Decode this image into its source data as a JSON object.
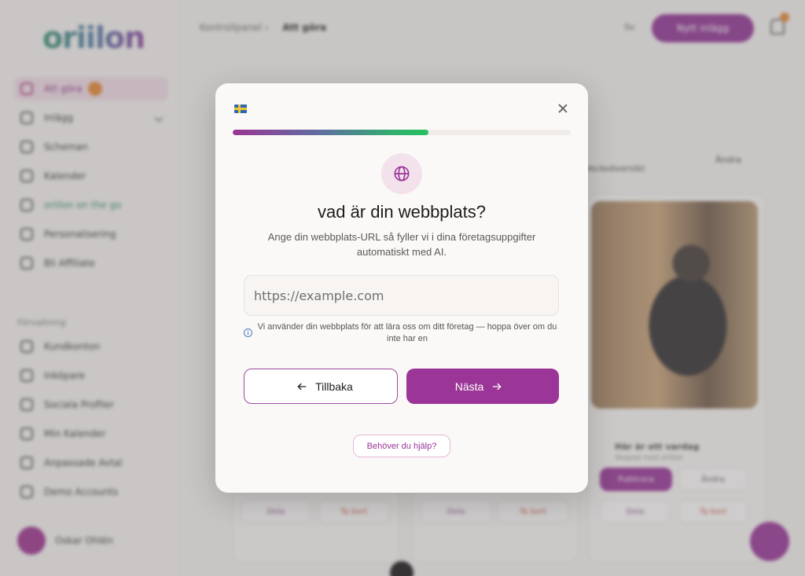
{
  "background": {
    "logo": "oriilon",
    "nav": [
      {
        "label": "Att göra",
        "active": true
      },
      {
        "label": "Inlägg"
      },
      {
        "label": "Scheman"
      },
      {
        "label": "Kalender"
      },
      {
        "label": "oriilon on the go"
      },
      {
        "label": "Personalisering"
      },
      {
        "label": "Bli Affiliate"
      }
    ],
    "section_label": "Förvaltning",
    "nav2": [
      {
        "label": "Kundkonton"
      },
      {
        "label": "Inköpare"
      },
      {
        "label": "Sociala Profiler"
      },
      {
        "label": "Min Kalender"
      },
      {
        "label": "Anpassade Avtal"
      },
      {
        "label": "Demo Accounts"
      }
    ],
    "user_name": "Oskar Ohlén",
    "breadcrumb": {
      "parent": "Kontrollpanel",
      "current": "Att göra"
    },
    "lang": "Sv",
    "new_post_label": "Nytt inlägg",
    "card_text": {
      "filter": "Ändra",
      "tab": "Veckoöversikt",
      "post_title": "Här är ett vardag",
      "post_sub": "Skapad med oriilon"
    },
    "card_buttons": {
      "publish": "Publicera",
      "edit": "Ändra",
      "share": "Dela",
      "delete": "Ta bort"
    }
  },
  "modal": {
    "flag": "swedish-flag",
    "progress": 0.58,
    "title": "vad är din webbplats?",
    "subtitle": "Ange din webbplats-URL så fyller vi i dina företagsuppgifter automatiskt med AI.",
    "url_placeholder": "https://example.com",
    "url_value": "",
    "info_text": "Vi använder din webbplats för att lära oss om ditt företag — hoppa över om du inte har en",
    "back_label": "Tillbaka",
    "next_label": "Nästa",
    "help_label": "Behöver du hjälp?"
  },
  "colors": {
    "accent": "#9b3597",
    "progress_start": "#9b3594",
    "progress_end": "#28c060"
  }
}
